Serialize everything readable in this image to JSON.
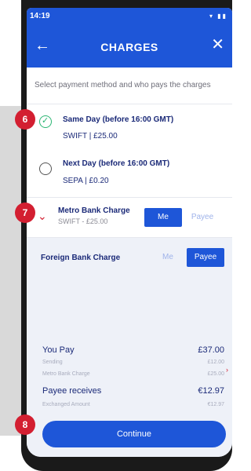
{
  "status": {
    "time": "14:19",
    "icons": "▾ ▮▮"
  },
  "header": {
    "back_icon": "←",
    "title": "CHARGES",
    "close_icon": "✕"
  },
  "instruction": "Select payment method and who pays the charges",
  "methods": [
    {
      "title": "Same Day (before 16:00 GMT)",
      "subtitle": "SWIFT | £25.00",
      "selected": true
    },
    {
      "title": "Next Day (before 16:00 GMT)",
      "subtitle": "SEPA | £0.20",
      "selected": false
    }
  ],
  "charges": [
    {
      "title": "Metro Bank Charge",
      "subtitle": "SWIFT - £25.00",
      "me_label": "Me",
      "payee_label": "Payee",
      "selected": "Me"
    },
    {
      "title": "Foreign Bank Charge",
      "me_label": "Me",
      "payee_label": "Payee",
      "selected": "Payee"
    }
  ],
  "summary": {
    "you_pay_label": "You Pay",
    "you_pay_value": "£37.00",
    "sending_label": "Sending",
    "sending_value": "£12.00",
    "metro_charge_label": "Metro Bank Charge",
    "metro_charge_value": "£25.00",
    "payee_receives_label": "Payee receives",
    "payee_receives_value": "€12.97",
    "exchanged_label": "Exchanged Amount",
    "exchanged_value": "€12.97"
  },
  "continue_label": "Continue",
  "annotations": [
    "6",
    "7",
    "8"
  ],
  "colors": {
    "primary": "#1e56d8",
    "accent_red": "#d31f31",
    "success_green": "#2bb673",
    "navy_text": "#1b2a78"
  }
}
